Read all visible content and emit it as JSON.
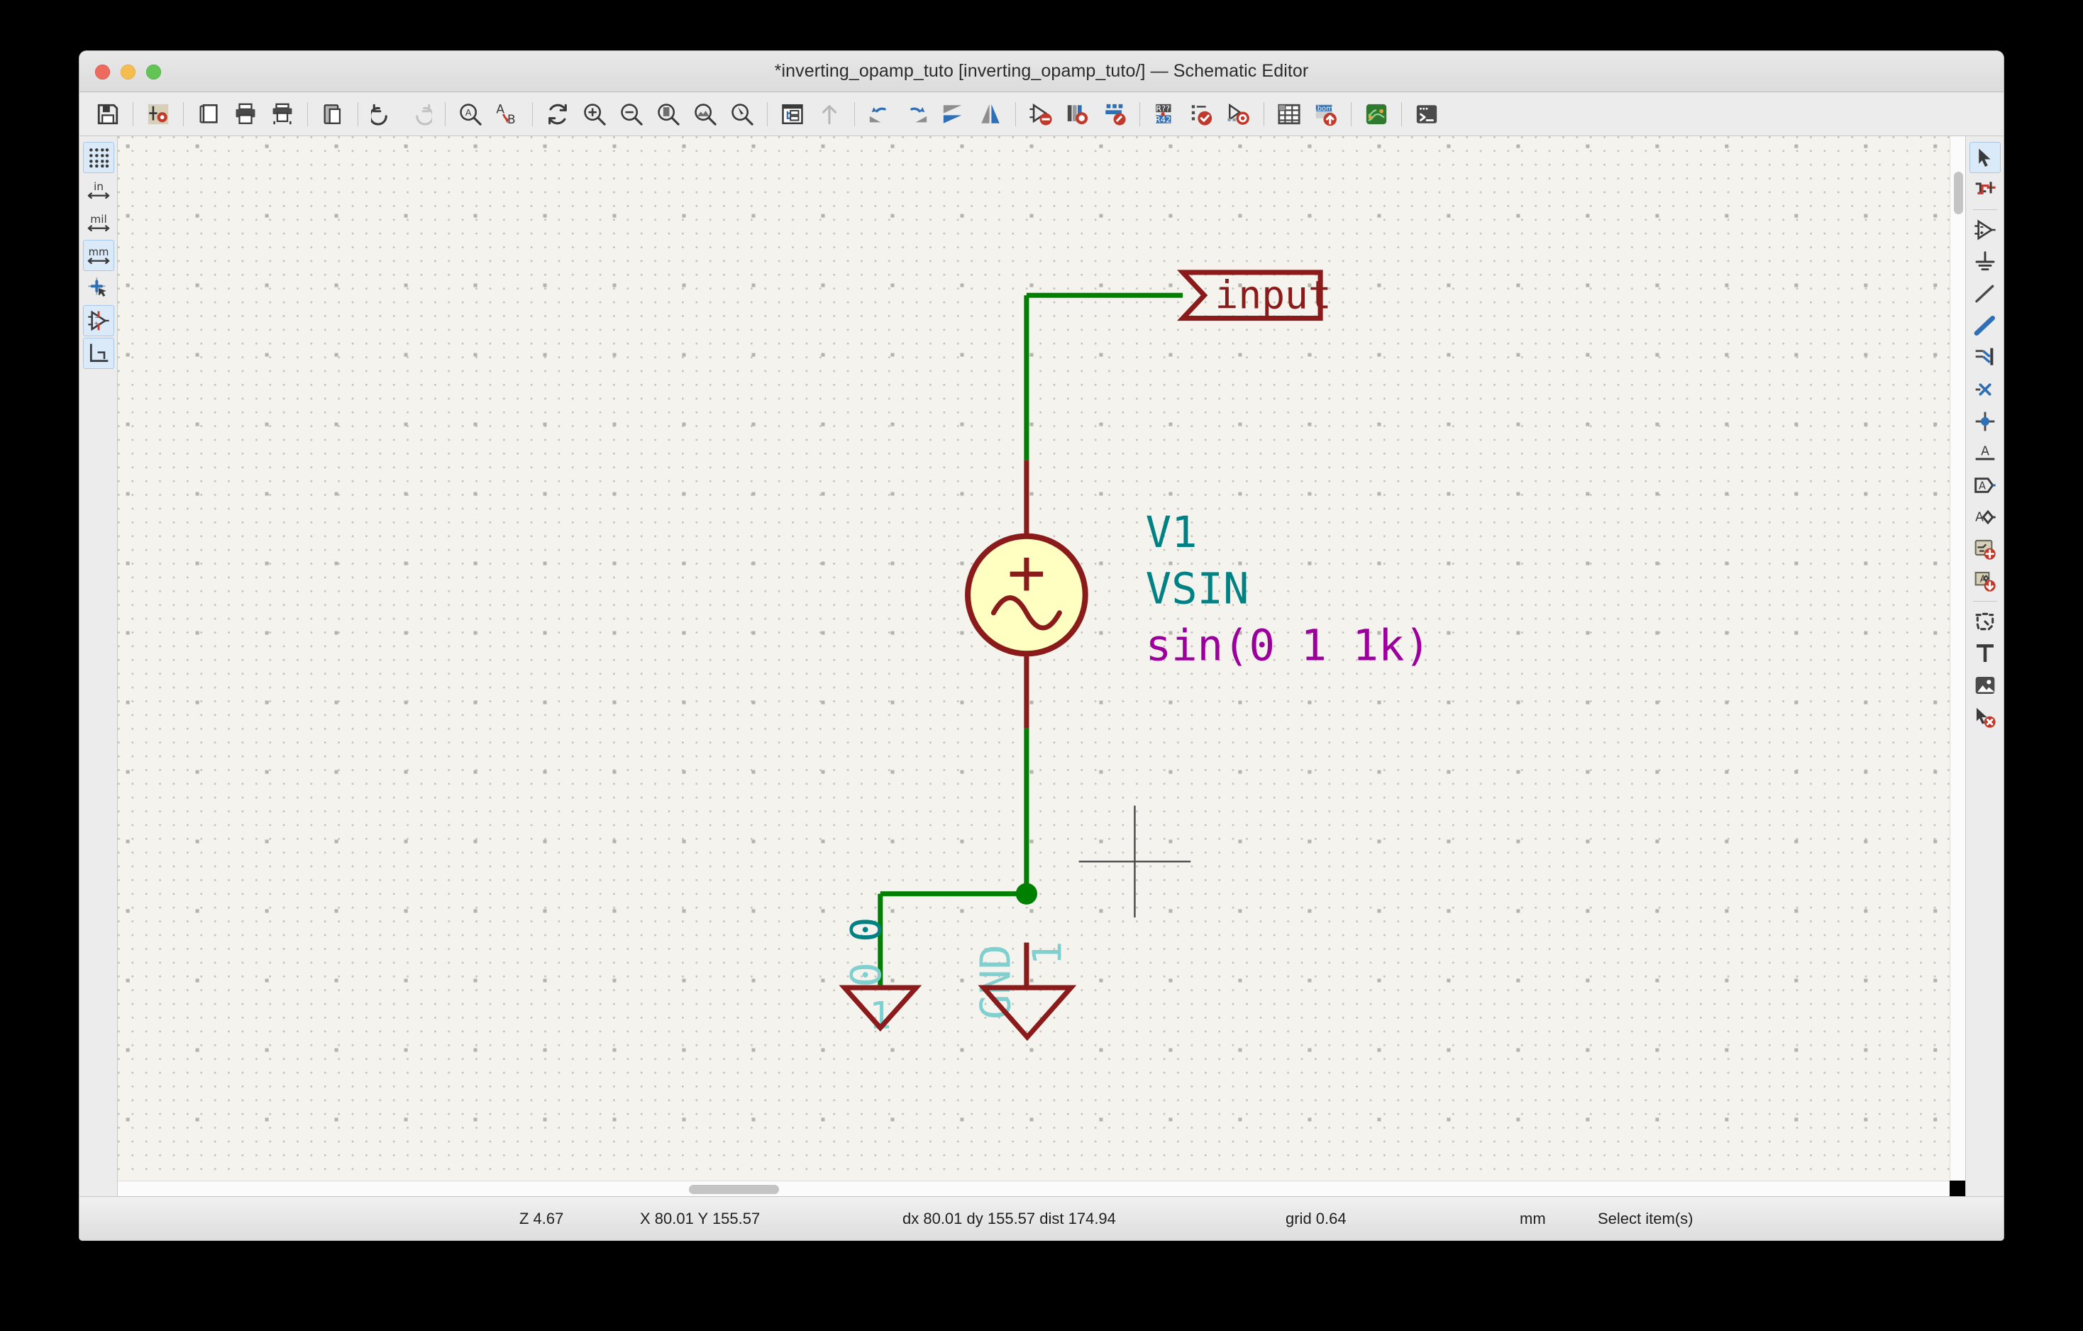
{
  "window": {
    "title": "*inverting_opamp_tuto [inverting_opamp_tuto/] — Schematic Editor",
    "traffic_lights": [
      "close",
      "minimize",
      "zoom"
    ]
  },
  "toolbar": {
    "items": [
      {
        "name": "save-button",
        "icon": "floppy-disk-icon",
        "label": "Save"
      },
      {
        "name": "sep1",
        "icon": "separator",
        "label": ""
      },
      {
        "name": "page-settings-button",
        "icon": "page-settings-icon",
        "label": "Page Settings"
      },
      {
        "name": "sep2",
        "icon": "separator",
        "label": ""
      },
      {
        "name": "page-properties-button",
        "icon": "document-icon",
        "label": "Page Properties"
      },
      {
        "name": "print-button",
        "icon": "printer-icon",
        "label": "Print"
      },
      {
        "name": "plot-button",
        "icon": "plotter-icon",
        "label": "Plot"
      },
      {
        "name": "sep3",
        "icon": "separator",
        "label": ""
      },
      {
        "name": "paste-button",
        "icon": "clipboard-icon",
        "label": "Paste"
      },
      {
        "name": "sep4",
        "icon": "separator",
        "label": ""
      },
      {
        "name": "undo-button",
        "icon": "undo-arrow-icon",
        "label": "Undo"
      },
      {
        "name": "redo-button",
        "icon": "redo-arrow-icon",
        "label": "Redo"
      },
      {
        "name": "sep5",
        "icon": "separator",
        "label": ""
      },
      {
        "name": "find-button",
        "icon": "find-magnifier-icon",
        "label": "Find"
      },
      {
        "name": "find-replace-button",
        "icon": "find-replace-icon",
        "label": "Find and Replace"
      },
      {
        "name": "sep6",
        "icon": "separator",
        "label": ""
      },
      {
        "name": "refresh-button",
        "icon": "refresh-icon",
        "label": "Refresh"
      },
      {
        "name": "zoom-in-button",
        "icon": "zoom-in-icon",
        "label": "Zoom In"
      },
      {
        "name": "zoom-out-button",
        "icon": "zoom-out-icon",
        "label": "Zoom Out"
      },
      {
        "name": "zoom-fit-page-button",
        "icon": "zoom-fit-page-icon",
        "label": "Zoom to Fit Page"
      },
      {
        "name": "zoom-fit-objects-button",
        "icon": "zoom-fit-objects-icon",
        "label": "Zoom to Fit Objects"
      },
      {
        "name": "zoom-selection-button",
        "icon": "zoom-selection-icon",
        "label": "Zoom to Selection"
      },
      {
        "name": "sep7",
        "icon": "separator",
        "label": ""
      },
      {
        "name": "hierarchy-navigator-button",
        "icon": "hierarchy-tree-icon",
        "label": "Show Hierarchy Navigator"
      },
      {
        "name": "leave-sheet-button",
        "icon": "up-arrow-icon",
        "label": "Leave Sheet"
      },
      {
        "name": "sep8",
        "icon": "separator",
        "label": ""
      },
      {
        "name": "rotate-ccw-button",
        "icon": "rotate-ccw-icon",
        "label": "Rotate Counterclockwise"
      },
      {
        "name": "rotate-cw-button",
        "icon": "rotate-cw-icon",
        "label": "Rotate Clockwise"
      },
      {
        "name": "mirror-horizontal-button",
        "icon": "mirror-horizontal-icon",
        "label": "Mirror Horizontally"
      },
      {
        "name": "mirror-vertical-button",
        "icon": "mirror-vertical-icon",
        "label": "Mirror Vertically"
      },
      {
        "name": "sep9",
        "icon": "separator",
        "label": ""
      },
      {
        "name": "symbol-properties-button",
        "icon": "symbol-edit-icon",
        "label": "Edit Symbol Properties"
      },
      {
        "name": "symbol-library-browser-button",
        "icon": "library-browser-icon",
        "label": "Symbol Library Browser"
      },
      {
        "name": "symbol-editor-button",
        "icon": "symbol-editor-icon",
        "label": "Symbol Editor"
      },
      {
        "name": "sep10",
        "icon": "separator",
        "label": ""
      },
      {
        "name": "annotate-button",
        "icon": "annotate-r42-icon",
        "label": "Annotate Schematic"
      },
      {
        "name": "erc-button",
        "icon": "erc-check-icon",
        "label": "Electrical Rules Checker"
      },
      {
        "name": "assign-footprints-button",
        "icon": "assign-footprints-icon",
        "label": "Assign Footprints"
      },
      {
        "name": "sep11",
        "icon": "separator",
        "label": ""
      },
      {
        "name": "bom-table-button",
        "icon": "spreadsheet-icon",
        "label": "Fields Table"
      },
      {
        "name": "generate-bom-button",
        "icon": "bom-export-icon",
        "label": "Generate BOM"
      },
      {
        "name": "sep12",
        "icon": "separator",
        "label": ""
      },
      {
        "name": "open-pcb-editor-button",
        "icon": "pcb-board-icon",
        "label": "Open PCB Editor"
      },
      {
        "name": "sep13",
        "icon": "separator",
        "label": ""
      },
      {
        "name": "scripting-console-button",
        "icon": "terminal-icon",
        "label": "Scripting Console"
      }
    ]
  },
  "left_toolbar": {
    "items": [
      {
        "name": "toggle-grid-button",
        "icon": "grid-dots-icon",
        "label": "Toggle Grid Display",
        "active": true
      },
      {
        "name": "units-inches-button",
        "icon": "inches-unit-icon",
        "label": "in",
        "active": false
      },
      {
        "name": "units-mils-button",
        "icon": "mils-unit-icon",
        "label": "mil",
        "active": false
      },
      {
        "name": "units-millimeters-button",
        "icon": "millimeters-unit-icon",
        "label": "mm",
        "active": true
      },
      {
        "name": "toggle-cursor-button",
        "icon": "full-crosshair-cursor-icon",
        "label": "Toggle Full-Window Crosshair",
        "active": false
      },
      {
        "name": "toggle-invisible-pins-button",
        "icon": "hidden-pins-icon",
        "label": "Show Hidden Pins",
        "active": true
      },
      {
        "name": "toggle-wire-angle-button",
        "icon": "wire-angle-icon",
        "label": "Force H/V Wires and Buses",
        "active": true
      }
    ],
    "unit_labels": {
      "inches": "in",
      "mils": "mil",
      "millimeters": "mm"
    }
  },
  "right_toolbar": {
    "items": [
      {
        "name": "select-tool-button",
        "icon": "arrow-cursor-icon",
        "label": "Select Item(s)",
        "active": true
      },
      {
        "name": "highlight-net-tool-button",
        "icon": "highlight-net-icon",
        "label": "Highlight Net",
        "active": false
      },
      {
        "name": "sep-a",
        "icon": "separator",
        "label": "",
        "active": false
      },
      {
        "name": "place-symbol-button",
        "icon": "opamp-symbol-icon",
        "label": "Add Symbol",
        "active": false
      },
      {
        "name": "place-power-button",
        "icon": "power-port-icon",
        "label": "Add Power Port",
        "active": false
      },
      {
        "name": "draw-wire-button",
        "icon": "wire-line-icon",
        "label": "Draw Wires",
        "active": false
      },
      {
        "name": "draw-bus-button",
        "icon": "bus-line-icon",
        "label": "Draw Buses",
        "active": false
      },
      {
        "name": "bus-entry-button",
        "icon": "bus-entry-icon",
        "label": "Add Wire to Bus Entry",
        "active": false
      },
      {
        "name": "no-connect-button",
        "icon": "no-connect-x-icon",
        "label": "Add No Connect Flag",
        "active": false
      },
      {
        "name": "junction-button",
        "icon": "junction-dot-icon",
        "label": "Add Junction",
        "active": false
      },
      {
        "name": "net-label-button",
        "icon": "net-label-icon",
        "label": "Add Net Label",
        "active": false
      },
      {
        "name": "global-label-button",
        "icon": "global-label-icon",
        "label": "Add Global Label",
        "active": false
      },
      {
        "name": "hierarchical-label-button",
        "icon": "hierarchical-label-icon",
        "label": "Add Hierarchical Label",
        "active": false
      },
      {
        "name": "add-sheet-button",
        "icon": "add-sheet-icon",
        "label": "Add Hierarchical Sheet",
        "active": false
      },
      {
        "name": "import-sheet-pin-button",
        "icon": "import-sheet-pin-icon",
        "label": "Import Sheet Pin",
        "active": false
      },
      {
        "name": "sep-b",
        "icon": "separator",
        "label": "",
        "active": false
      },
      {
        "name": "draw-lines-button",
        "icon": "graphic-polygon-icon",
        "label": "Draw Lines",
        "active": false
      },
      {
        "name": "add-text-button",
        "icon": "text-t-icon",
        "label": "Add Text",
        "active": false
      },
      {
        "name": "add-image-button",
        "icon": "image-icon",
        "label": "Add Image",
        "active": false
      },
      {
        "name": "delete-tool-button",
        "icon": "delete-cursor-icon",
        "label": "Delete Items",
        "active": false
      }
    ]
  },
  "schematic": {
    "global_label": {
      "text": "input",
      "color": "#8b1a1a"
    },
    "source": {
      "reference": "V1",
      "value": "VSIN",
      "spice_model": "sin(0 1 1k)",
      "plus_sign": "+",
      "reference_color": "#008284",
      "value_color": "#008284",
      "model_color": "#9c009c",
      "body_fill": "#ffffc2",
      "body_stroke": "#8b1a1a"
    },
    "power_ports": [
      {
        "name": "gnd-left",
        "visible_label": "",
        "pin_number": "1",
        "pin_name": "0",
        "hidden_name": "0"
      },
      {
        "name": "gnd-right",
        "visible_label": "GND",
        "pin_number": "1",
        "pin_name": "GND",
        "hidden_name": "GND"
      }
    ],
    "ground_label": "GND",
    "colors": {
      "wire": "#008000",
      "pin": "#8b1a1a",
      "junction": "#008000",
      "hidden_text": "#80d0d0",
      "pin_text": "#008284",
      "grid_dot": "#c3c3bd",
      "background": "#f4f3ee"
    }
  },
  "statusbar": {
    "zoom": "Z 4.67",
    "cursor_position": "X 80.01  Y 155.57",
    "relative": "dx 80.01  dy 155.57  dist 174.94",
    "grid": "grid 0.64",
    "units": "mm",
    "tool": "Select item(s)"
  }
}
